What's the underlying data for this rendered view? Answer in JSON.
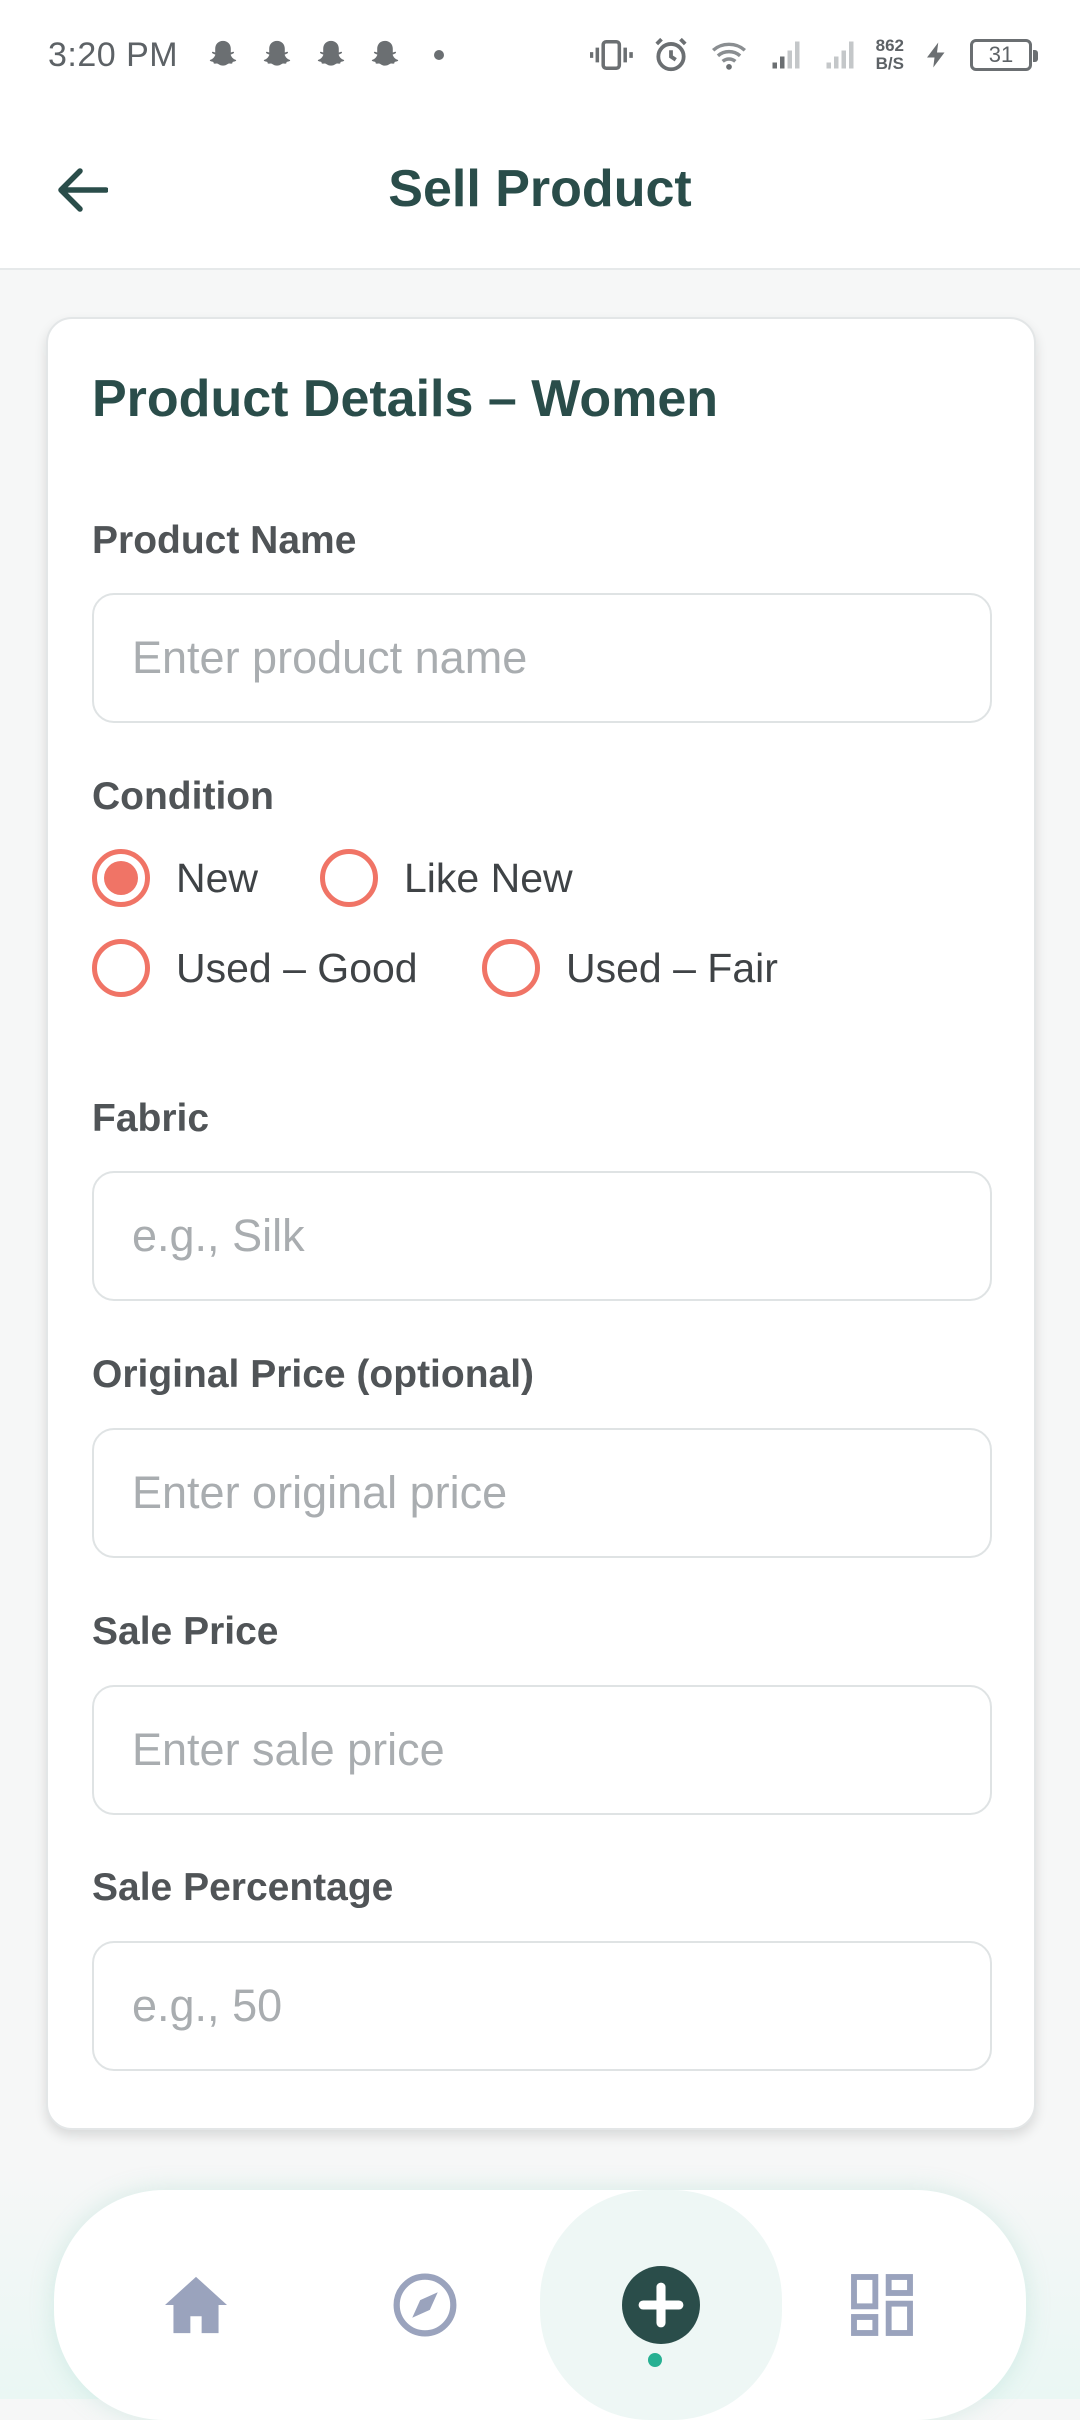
{
  "status_bar": {
    "time": "3:20 PM",
    "net_speed_value": "862",
    "net_speed_unit": "B/S",
    "battery": "31"
  },
  "header": {
    "title": "Sell Product",
    "back_icon": "arrow-left-icon"
  },
  "form": {
    "title": "Product Details – Women",
    "product_name": {
      "label": "Product Name",
      "placeholder": "Enter product name",
      "value": ""
    },
    "condition": {
      "label": "Condition",
      "options": [
        "New",
        "Like New",
        "Used – Good",
        "Used – Fair"
      ],
      "selected": "New"
    },
    "fabric": {
      "label": "Fabric",
      "placeholder": "e.g., Silk",
      "value": ""
    },
    "original_price": {
      "label": "Original Price (optional)",
      "placeholder": "Enter original price",
      "value": ""
    },
    "sale_price": {
      "label": "Sale Price",
      "placeholder": "Enter sale price",
      "value": ""
    },
    "sale_percentage": {
      "label": "Sale Percentage",
      "placeholder": "e.g., 50",
      "value": ""
    }
  },
  "bottom_nav": {
    "items": [
      "home-icon",
      "compass-icon",
      "add-icon",
      "dashboard-icon"
    ],
    "active": "add-icon"
  },
  "colors": {
    "primary_dark": "#2a4d4a",
    "accent_coral": "#f07466",
    "nav_inactive": "#9aa3bd",
    "nav_dot": "#27b092"
  }
}
